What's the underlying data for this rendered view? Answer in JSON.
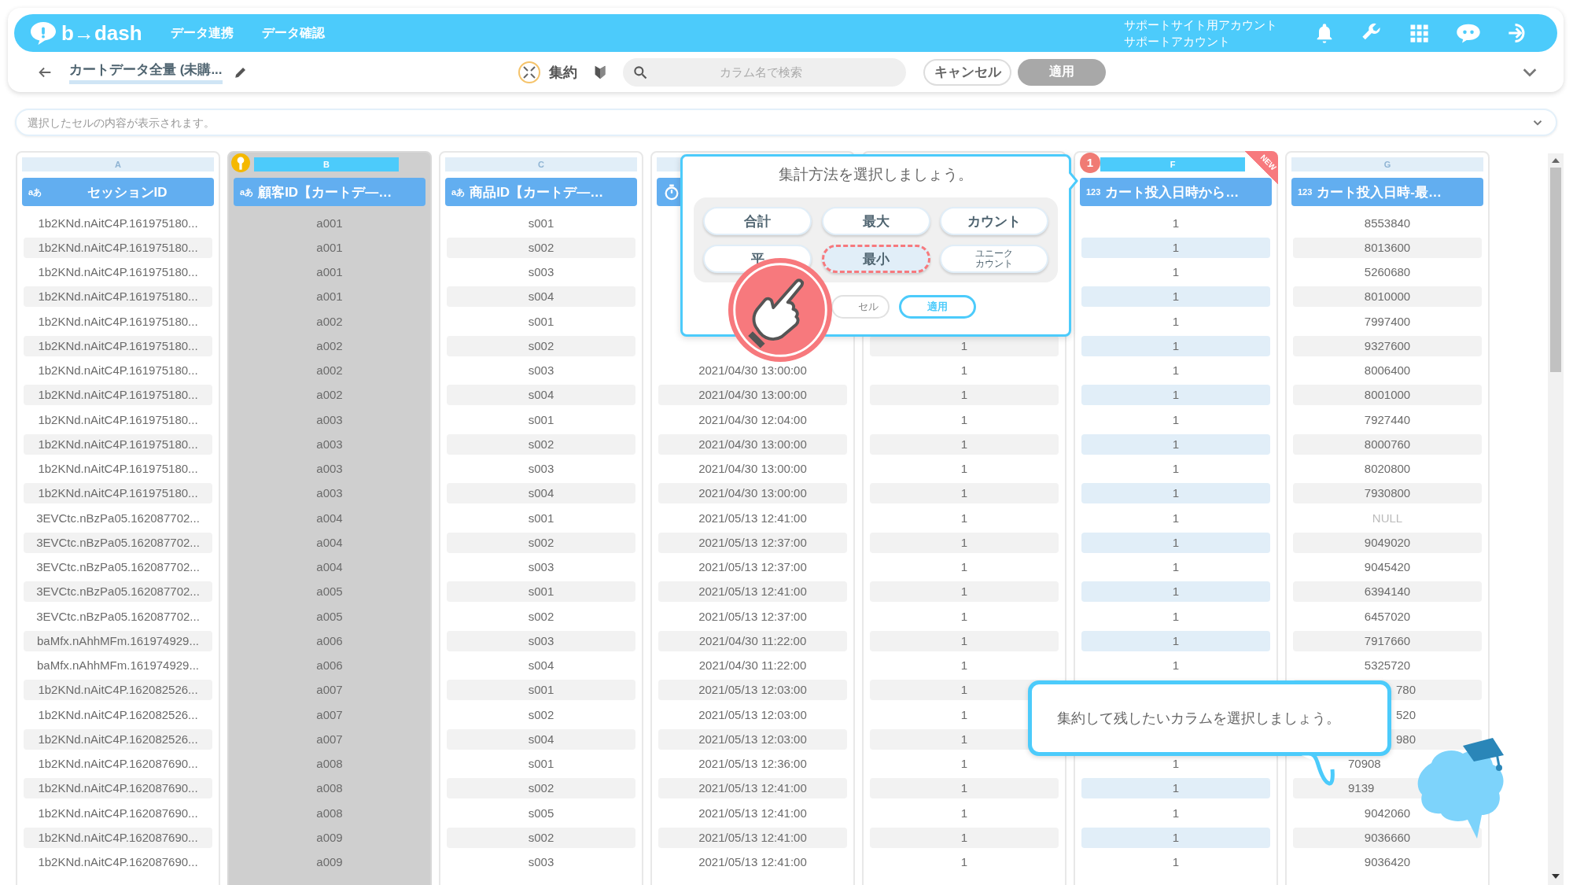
{
  "header": {
    "logo": "b→dash",
    "nav": [
      {
        "label": "データ連携"
      },
      {
        "label": "データ確認"
      }
    ],
    "account": [
      "サポートサイト用アカウント",
      "サポートアカウント"
    ]
  },
  "toolbar": {
    "title": "カートデータ全量 (未購...",
    "mode_label": "集約",
    "search": {
      "placeholder": "カラム名で検索"
    },
    "cancel": "キャンセル",
    "apply": {
      "label": "適用",
      "disabled": true
    }
  },
  "cell_bar": {
    "placeholder": "選択したセルの内容が表示されます。"
  },
  "columns": [
    {
      "letter": "A",
      "kind": "text",
      "type_label": "aあ",
      "title": "セッションID",
      "selected": false,
      "cells": [
        "1b2KNd.nAitC4P.161975180...",
        "1b2KNd.nAitC4P.161975180...",
        "1b2KNd.nAitC4P.161975180...",
        "1b2KNd.nAitC4P.161975180...",
        "1b2KNd.nAitC4P.161975180...",
        "1b2KNd.nAitC4P.161975180...",
        "1b2KNd.nAitC4P.161975180...",
        "1b2KNd.nAitC4P.161975180...",
        "1b2KNd.nAitC4P.161975180...",
        "1b2KNd.nAitC4P.161975180...",
        "1b2KNd.nAitC4P.161975180...",
        "1b2KNd.nAitC4P.161975180...",
        "3EVCtc.nBzPa05.162087702...",
        "3EVCtc.nBzPa05.162087702...",
        "3EVCtc.nBzPa05.162087702...",
        "3EVCtc.nBzPa05.162087702...",
        "3EVCtc.nBzPa05.162087702...",
        "baMfx.nAhhMFm.161974929...",
        "baMfx.nAhhMFm.161974929...",
        "1b2KNd.nAitC4P.162082526...",
        "1b2KNd.nAitC4P.162082526...",
        "1b2KNd.nAitC4P.162082526...",
        "1b2KNd.nAitC4P.162087690...",
        "1b2KNd.nAitC4P.162087690...",
        "1b2KNd.nAitC4P.162087690...",
        "1b2KNd.nAitC4P.162087690...",
        "1b2KNd.nAitC4P.162087690..."
      ]
    },
    {
      "letter": "B",
      "kind": "text",
      "type_label": "aあ",
      "title": "顧客ID【カートデ―…",
      "selected": true,
      "cells": [
        "a001",
        "a001",
        "a001",
        "a001",
        "a002",
        "a002",
        "a002",
        "a002",
        "a003",
        "a003",
        "a003",
        "a003",
        "a004",
        "a004",
        "a004",
        "a005",
        "a005",
        "a006",
        "a006",
        "a007",
        "a007",
        "a007",
        "a008",
        "a008",
        "a008",
        "a009",
        "a009"
      ]
    },
    {
      "letter": "C",
      "kind": "text",
      "type_label": "aあ",
      "title": "商品ID【カートデ―…",
      "selected": false,
      "cells": [
        "s001",
        "s002",
        "s003",
        "s004",
        "s001",
        "s002",
        "s003",
        "s004",
        "s001",
        "s002",
        "s003",
        "s004",
        "s001",
        "s002",
        "s003",
        "s001",
        "s002",
        "s003",
        "s004",
        "s001",
        "s002",
        "s004",
        "s001",
        "s002",
        "s005",
        "s002",
        "s003"
      ]
    },
    {
      "kind": "datetime",
      "selected": false,
      "cells": [
        null,
        null,
        null,
        null,
        null,
        null,
        "2021/04/30 13:00:00",
        "2021/04/30 13:00:00",
        "2021/04/30 12:04:00",
        "2021/04/30 13:00:00",
        "2021/04/30 13:00:00",
        "2021/04/30 13:00:00",
        "2021/05/13 12:41:00",
        "2021/05/13 12:37:00",
        "2021/05/13 12:37:00",
        "2021/05/13 12:41:00",
        "2021/05/13 12:37:00",
        "2021/04/30 11:22:00",
        "2021/04/30 11:22:00",
        "2021/05/13 12:03:00",
        "2021/05/13 12:03:00",
        "2021/05/13 12:03:00",
        "2021/05/13 12:36:00",
        "2021/05/13 12:41:00",
        "2021/05/13 12:41:00",
        "2021/05/13 12:41:00",
        "2021/05/13 12:41:00"
      ]
    },
    {
      "selected": false,
      "cells": [
        null,
        null,
        null,
        null,
        null,
        "1",
        "1",
        "1",
        "1",
        "1",
        "1",
        "1",
        "1",
        "1",
        "1",
        "1",
        "1",
        "1",
        "1",
        "1",
        "1",
        "1",
        "1",
        "1",
        "1",
        "1",
        "1"
      ]
    },
    {
      "letter": "F",
      "kind": "number",
      "type_label": "123",
      "title": "カート投入日時から…",
      "selected": false,
      "badge": "1",
      "ribbon": "NEW",
      "cells": [
        "1",
        "1",
        "1",
        "1",
        "1",
        "1",
        "1",
        "1",
        "1",
        "1",
        "1",
        "1",
        "1",
        "1",
        "1",
        "1",
        "1",
        "1",
        "1",
        null,
        null,
        null,
        "1",
        "1",
        "1",
        "1",
        "1"
      ]
    },
    {
      "letter": "G",
      "kind": "number",
      "type_label": "123",
      "title": "カート投入日時-最…",
      "selected": false,
      "cells": [
        "8553840",
        "8013600",
        "5260680",
        "8010000",
        "7997400",
        "9327600",
        "8006400",
        "8001000",
        "7927440",
        "8000760",
        "8020800",
        "7930800",
        {
          "text": "NULL",
          "kind": "null-value"
        },
        "9049020",
        "9045420",
        "6394140",
        "6457020",
        "7917660",
        "5325720",
        {
          "text": "780",
          "kind": "tail"
        },
        {
          "text": "520",
          "kind": "tail"
        },
        {
          "text": "980",
          "kind": "tail"
        },
        {
          "text": "70908",
          "kind": "head"
        },
        {
          "text": "9139",
          "kind": "head"
        },
        "9042060",
        "9036660",
        "9036420"
      ]
    }
  ],
  "popup": {
    "title": "集計方法を選択しましょう。",
    "methods": [
      {
        "label": "合計",
        "selected": false
      },
      {
        "label": "最大",
        "selected": false
      },
      {
        "label": "カウント",
        "selected": false
      },
      {
        "label": "平",
        "selected": false
      },
      {
        "label": "最小",
        "selected": true
      },
      {
        "label": "ユニークカウント",
        "selected": false,
        "kind": "two-line"
      }
    ],
    "cancel": "セル",
    "apply": "適用"
  },
  "tip": {
    "text": "集約して残したいカラムを選択しましょう。"
  }
}
